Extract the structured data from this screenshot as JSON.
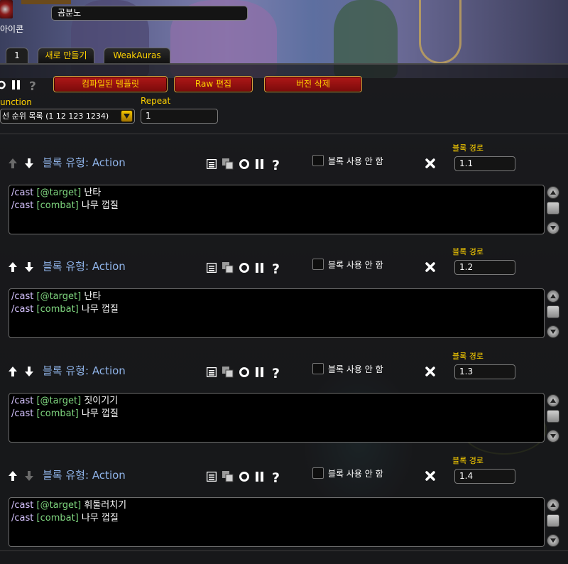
{
  "header": {
    "icon_label": "아이콘",
    "name_value": "곰분노"
  },
  "tabs": [
    {
      "label": "1"
    },
    {
      "label": "새로 만들기"
    },
    {
      "label": "WeakAuras"
    }
  ],
  "toolbar": {
    "compiled_template_label": "컴파일된 템플릿",
    "raw_edit_label": "Raw 편집",
    "delete_version_label": "버전 삭제"
  },
  "function": {
    "label": "unction",
    "selected": "선 순위 목록 (1 12 123 1234)"
  },
  "repeat": {
    "label": "Repeat",
    "value": "1"
  },
  "blocks": [
    {
      "type_label": "블록 유형:",
      "type_value": "Action",
      "disable_label": "블록 사용 안 함",
      "path_label": "블록 경로",
      "path_value": "1.1",
      "up_enabled": false,
      "down_enabled": true,
      "lines": [
        {
          "cmd": "/cast",
          "cond": "[@target]",
          "spell": "난타"
        },
        {
          "cmd": "/cast",
          "cond": "[combat]",
          "spell": "나무 껍질"
        }
      ]
    },
    {
      "type_label": "블록 유형:",
      "type_value": "Action",
      "disable_label": "블록 사용 안 함",
      "path_label": "블록 경로",
      "path_value": "1.2",
      "up_enabled": true,
      "down_enabled": true,
      "lines": [
        {
          "cmd": "/cast",
          "cond": "[@target]",
          "spell": "난타"
        },
        {
          "cmd": "/cast",
          "cond": "[combat]",
          "spell": "나무 껍질"
        }
      ]
    },
    {
      "type_label": "블록 유형:",
      "type_value": "Action",
      "disable_label": "블록 사용 안 함",
      "path_label": "블록 경로",
      "path_value": "1.3",
      "up_enabled": true,
      "down_enabled": true,
      "lines": [
        {
          "cmd": "/cast",
          "cond": "[@target]",
          "spell": "짓이기기"
        },
        {
          "cmd": "/cast",
          "cond": "[combat]",
          "spell": "나무 껍질"
        }
      ]
    },
    {
      "type_label": "블록 유형:",
      "type_value": "Action",
      "disable_label": "블록 사용 안 함",
      "path_label": "블록 경로",
      "path_value": "1.4",
      "up_enabled": true,
      "down_enabled": false,
      "lines": [
        {
          "cmd": "/cast",
          "cond": "[@target]",
          "spell": "휘둘러치기"
        },
        {
          "cmd": "/cast",
          "cond": "[combat]",
          "spell": "나무 껍질"
        }
      ]
    }
  ],
  "colors": {
    "gold": "#ffd200",
    "block_type": "#8fb3e8",
    "command": "#d6c3ff",
    "conditional": "#7fd67f",
    "button_red": "#9a1010"
  },
  "icons": [
    "sort-up-icon",
    "sort-down-icon",
    "toggle-icon",
    "pause-icon",
    "help-icon",
    "copy-icon",
    "delete-icon",
    "scroll-up-icon",
    "scroll-down-icon"
  ]
}
